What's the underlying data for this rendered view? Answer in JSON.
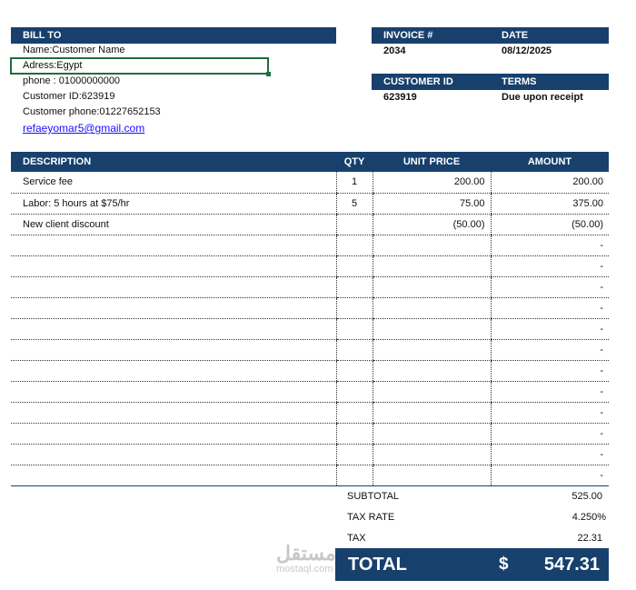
{
  "bill_to": {
    "header": "BILL TO",
    "name": "Name:Customer Name",
    "address": "Adress:Egypt",
    "phone": "phone : 01000000000",
    "customer_id": "Customer ID:623919",
    "customer_phone": "Customer phone:01227652153",
    "email": "refaeyomar5@gmail.com"
  },
  "invoice": {
    "invoice_label": "INVOICE #",
    "invoice_no": "2034",
    "date_label": "DATE",
    "date": "08/12/2025",
    "customer_id_label": "CUSTOMER ID",
    "customer_id": "623919",
    "terms_label": "TERMS",
    "terms": "Due upon receipt"
  },
  "table": {
    "headers": [
      "DESCRIPTION",
      "QTY",
      "UNIT PRICE",
      "AMOUNT"
    ],
    "rows": [
      {
        "desc": "Service fee",
        "qty": "1",
        "unit": "200.00",
        "amount": "200.00"
      },
      {
        "desc": "Labor: 5 hours at $75/hr",
        "qty": "5",
        "unit": "75.00",
        "amount": "375.00"
      },
      {
        "desc": "New client discount",
        "qty": "",
        "unit": "(50.00)",
        "amount": "(50.00)"
      },
      {
        "desc": "",
        "qty": "",
        "unit": "",
        "amount": "-"
      },
      {
        "desc": "",
        "qty": "",
        "unit": "",
        "amount": "-"
      },
      {
        "desc": "",
        "qty": "",
        "unit": "",
        "amount": "-"
      },
      {
        "desc": "",
        "qty": "",
        "unit": "",
        "amount": "-"
      },
      {
        "desc": "",
        "qty": "",
        "unit": "",
        "amount": "-"
      },
      {
        "desc": "",
        "qty": "",
        "unit": "",
        "amount": "-"
      },
      {
        "desc": "",
        "qty": "",
        "unit": "",
        "amount": "-"
      },
      {
        "desc": "",
        "qty": "",
        "unit": "",
        "amount": "-"
      },
      {
        "desc": "",
        "qty": "",
        "unit": "",
        "amount": "-"
      },
      {
        "desc": "",
        "qty": "",
        "unit": "",
        "amount": "-"
      },
      {
        "desc": "",
        "qty": "",
        "unit": "",
        "amount": "-"
      },
      {
        "desc": "",
        "qty": "",
        "unit": "",
        "amount": "-"
      }
    ]
  },
  "summary": {
    "subtotal_label": "SUBTOTAL",
    "subtotal": "525.00",
    "tax_rate_label": "TAX RATE",
    "tax_rate": "4.250%",
    "tax_label": "TAX",
    "tax": "22.31",
    "total_label": "TOTAL",
    "currency": "$",
    "total": "547.31"
  },
  "watermark": {
    "arabic": "مستقل",
    "latin": "mostaql.com"
  }
}
